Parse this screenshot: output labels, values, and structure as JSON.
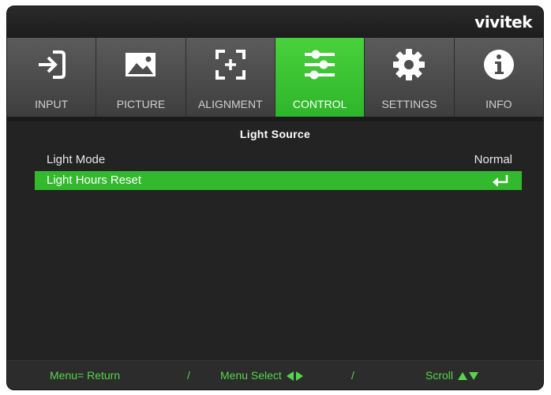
{
  "brand": {
    "logo_text": "vivitek"
  },
  "tabs": [
    {
      "label": "INPUT",
      "icon": "input-icon",
      "active": false
    },
    {
      "label": "PICTURE",
      "icon": "picture-icon",
      "active": false
    },
    {
      "label": "ALIGNMENT",
      "icon": "alignment-icon",
      "active": false
    },
    {
      "label": "CONTROL",
      "icon": "control-sliders-icon",
      "active": true
    },
    {
      "label": "SETTINGS",
      "icon": "gear-icon",
      "active": false
    },
    {
      "label": "INFO",
      "icon": "info-icon",
      "active": false
    }
  ],
  "section": {
    "title": "Light Source"
  },
  "items": [
    {
      "label": "Light Mode",
      "value": "Normal",
      "selected": false
    },
    {
      "label": "Light Hours Reset",
      "value_icon": "enter-icon",
      "selected": true
    }
  ],
  "footer": {
    "return_hint": "Menu= Return",
    "separator": "/",
    "select_hint": "Menu Select",
    "scroll_hint": "Scroll"
  },
  "colors": {
    "accent_green": "#33b92d",
    "hint_green": "#56d64a",
    "background": "#262626"
  }
}
